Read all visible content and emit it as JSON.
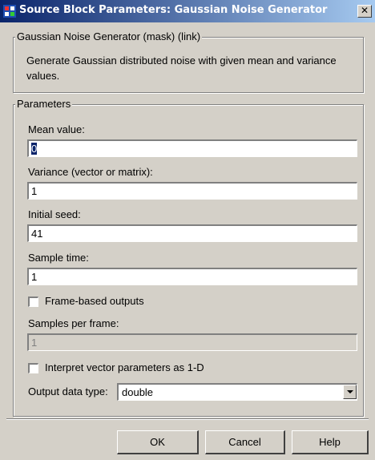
{
  "window": {
    "title": "Source Block Parameters: Gaussian Noise Generator",
    "close_glyph": "✕"
  },
  "mask_group": {
    "legend": "Gaussian Noise Generator (mask) (link)",
    "description": "Generate Gaussian distributed noise with given mean and variance values."
  },
  "params_group": {
    "legend": "Parameters",
    "mean_label": "Mean value:",
    "mean_value": "0",
    "variance_label": "Variance (vector or matrix):",
    "variance_value": "1",
    "seed_label": "Initial seed:",
    "seed_value": "41",
    "sample_time_label": "Sample time:",
    "sample_time_value": "1",
    "frame_based_label": "Frame-based outputs",
    "frame_based_checked": false,
    "samples_per_frame_label": "Samples per frame:",
    "samples_per_frame_value": "1",
    "interpret_1d_label": "Interpret vector parameters as 1-D",
    "interpret_1d_checked": false,
    "output_type_label": "Output data type:",
    "output_type_value": "double"
  },
  "buttons": {
    "ok": "OK",
    "cancel": "Cancel",
    "help": "Help"
  },
  "icons": {
    "window_icon": "simulink-block-icon",
    "dropdown": "chevron-down-icon"
  },
  "colors": {
    "titlebar_start": "#0a246a",
    "titlebar_end": "#a6caf0",
    "dialog_face": "#d4d0c8",
    "selection": "#0a246a"
  }
}
